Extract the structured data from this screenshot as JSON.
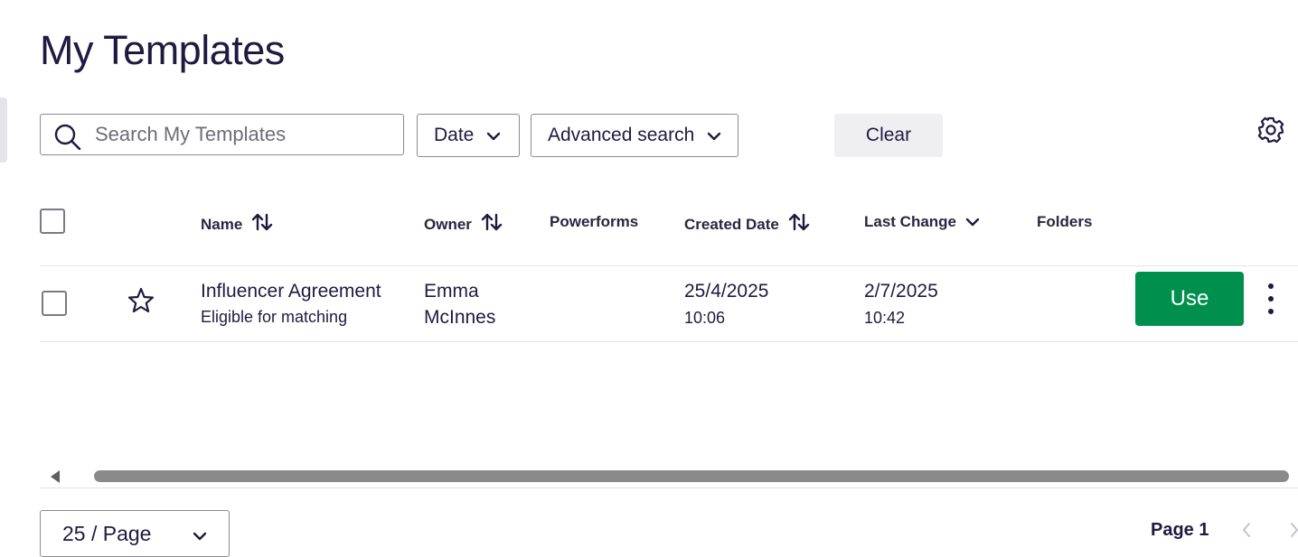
{
  "page": {
    "title": "My Templates"
  },
  "toolbar": {
    "search_placeholder": "Search My Templates",
    "search_value": "",
    "date_label": "Date",
    "advanced_search_label": "Advanced search",
    "clear_label": "Clear"
  },
  "table": {
    "columns": {
      "name": "Name",
      "owner": "Owner",
      "powerforms": "Powerforms",
      "created_date": "Created Date",
      "last_change": "Last Change",
      "folders": "Folders"
    },
    "rows": [
      {
        "name": "Influencer Agreement",
        "subtitle": "Eligible for matching",
        "owner_first": "Emma",
        "owner_last": "McInnes",
        "powerforms": "",
        "created_date": "25/4/2025",
        "created_time": "10:06",
        "last_change_date": "2/7/2025",
        "last_change_time": "10:42",
        "folders": "",
        "action_label": "Use"
      }
    ]
  },
  "pagination": {
    "per_page_label": "25 / Page",
    "page_label": "Page 1"
  },
  "colors": {
    "primary_text": "#1f1a40",
    "use_button": "#008f4c",
    "scrollbar": "#8a8a8a"
  },
  "icons": {
    "search": "search-icon",
    "chevron": "chevron-down-icon",
    "settings": "gear-icon",
    "sort": "sort-arrows-icon",
    "favorite": "star-outline-icon",
    "more": "kebab-menu-icon"
  }
}
